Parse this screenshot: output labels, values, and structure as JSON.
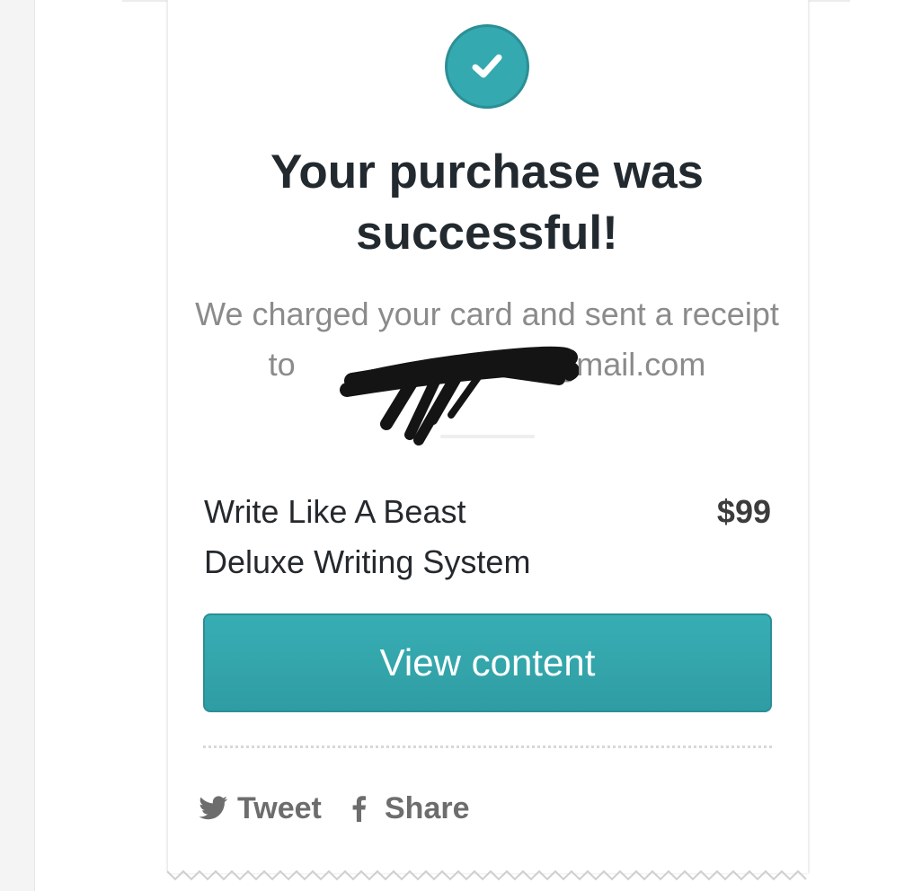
{
  "status": {
    "icon": "checkmark-icon",
    "heading": "Your purchase was successful!",
    "message_prefix": "We charged your card and sent a receipt to",
    "email_domain": "@gmail.com"
  },
  "product": {
    "name_line1": "Write Like A Beast",
    "name_line2": "Deluxe Writing System",
    "price": "$99"
  },
  "actions": {
    "view_content_label": "View content"
  },
  "social": {
    "tweet_label": "Tweet",
    "tweet_icon": "twitter-bird-icon",
    "share_label": "Share",
    "share_icon": "facebook-f-icon"
  },
  "colors": {
    "accent": "#34a9b0",
    "accent_dark": "#2b8f95",
    "heading": "#222a30",
    "muted": "#8b8b8b"
  }
}
